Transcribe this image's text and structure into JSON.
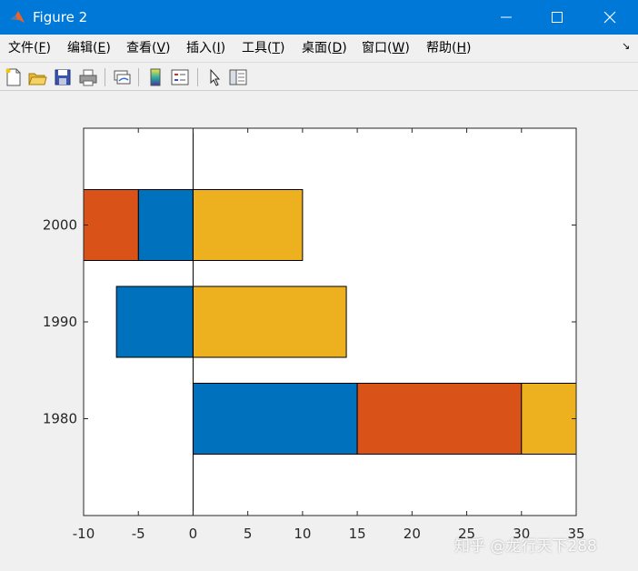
{
  "window": {
    "title": "Figure 2"
  },
  "menu": {
    "items": [
      {
        "label": "文件(",
        "key": "F",
        "suffix": ")"
      },
      {
        "label": "编辑(",
        "key": "E",
        "suffix": ")"
      },
      {
        "label": "查看(",
        "key": "V",
        "suffix": ")"
      },
      {
        "label": "插入(",
        "key": "I",
        "suffix": ")"
      },
      {
        "label": "工具(",
        "key": "T",
        "suffix": ")"
      },
      {
        "label": "桌面(",
        "key": "D",
        "suffix": ")"
      },
      {
        "label": "窗口(",
        "key": "W",
        "suffix": ")"
      },
      {
        "label": "帮助(",
        "key": "H",
        "suffix": ")"
      }
    ]
  },
  "toolbar": {
    "buttons": [
      "new-figure-icon",
      "open-file-icon",
      "save-icon",
      "print-icon",
      "link-plot-icon",
      "colorbar-icon",
      "legend-icon",
      "pointer-icon",
      "property-editor-icon"
    ]
  },
  "chart_data": {
    "type": "bar",
    "orientation": "horizontal",
    "stacked": true,
    "categories": [
      "1980",
      "1990",
      "2000"
    ],
    "series": [
      {
        "values": [
          15,
          -7,
          -5
        ],
        "color": "#0072bd"
      },
      {
        "values": [
          15,
          0,
          -5
        ],
        "color": "#d95319"
      },
      {
        "values": [
          15,
          14,
          10
        ],
        "color": "#edb120"
      }
    ],
    "xlim": [
      -10,
      35
    ],
    "xticks": [
      -10,
      -5,
      0,
      5,
      10,
      15,
      20,
      25,
      30,
      35
    ],
    "ylim": [
      1970,
      2010
    ],
    "yticks": [
      1980,
      1990,
      2000
    ],
    "grid": false,
    "baseline": 0
  },
  "watermark": "知乎 @龙行天下288"
}
